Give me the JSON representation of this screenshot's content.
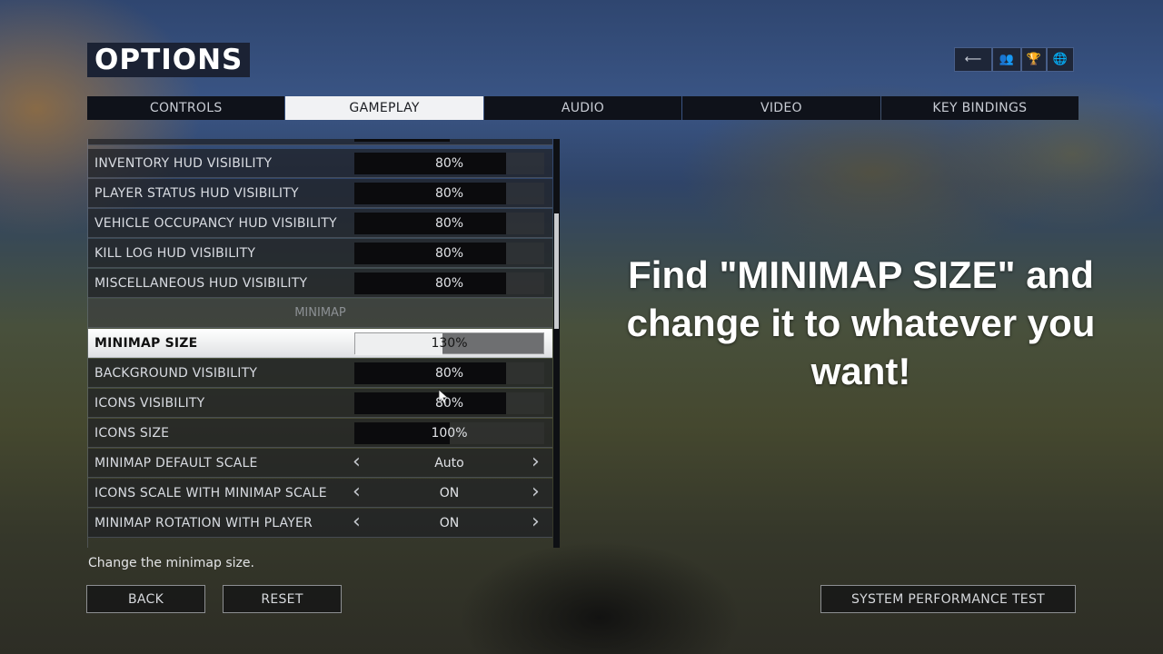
{
  "header": {
    "title": "OPTIONS"
  },
  "top_icons": [
    {
      "name": "back-arrow-icon",
      "glyph": "⟵"
    },
    {
      "name": "friends-icon",
      "glyph": "👥"
    },
    {
      "name": "trophy-icon",
      "glyph": "🏆"
    },
    {
      "name": "globe-icon",
      "glyph": "🌐"
    }
  ],
  "tabs": [
    {
      "label": "CONTROLS",
      "active": false
    },
    {
      "label": "GAMEPLAY",
      "active": true
    },
    {
      "label": "AUDIO",
      "active": false
    },
    {
      "label": "VIDEO",
      "active": false
    },
    {
      "label": "KEY BINDINGS",
      "active": false
    }
  ],
  "settings": {
    "rows": [
      {
        "label": "INVENTORY HUD VISIBILITY",
        "type": "slider",
        "value": "80%",
        "fraction": 0.8
      },
      {
        "label": "PLAYER STATUS HUD VISIBILITY",
        "type": "slider",
        "value": "80%",
        "fraction": 0.8
      },
      {
        "label": "VEHICLE OCCUPANCY HUD VISIBILITY",
        "type": "slider",
        "value": "80%",
        "fraction": 0.8
      },
      {
        "label": "KILL LOG HUD VISIBILITY",
        "type": "slider",
        "value": "80%",
        "fraction": 0.8
      },
      {
        "label": "MISCELLANEOUS HUD VISIBILITY",
        "type": "slider",
        "value": "80%",
        "fraction": 0.8
      },
      {
        "label": "MINIMAP",
        "type": "header"
      },
      {
        "label": "MINIMAP SIZE",
        "type": "slider",
        "value": "130%",
        "fraction": 0.46,
        "selected": true
      },
      {
        "label": "BACKGROUND VISIBILITY",
        "type": "slider",
        "value": "80%",
        "fraction": 0.8
      },
      {
        "label": "ICONS VISIBILITY",
        "type": "slider",
        "value": "80%",
        "fraction": 0.8
      },
      {
        "label": "ICONS SIZE",
        "type": "slider",
        "value": "100%",
        "fraction": 0.5
      },
      {
        "label": "MINIMAP DEFAULT SCALE",
        "type": "selector",
        "value": "Auto"
      },
      {
        "label": "ICONS SCALE WITH MINIMAP SCALE",
        "type": "selector",
        "value": "ON"
      },
      {
        "label": "MINIMAP ROTATION WITH PLAYER",
        "type": "selector",
        "value": "ON"
      }
    ],
    "partial_top_row_fraction": 0.5,
    "scroll_position": 0.35
  },
  "help_text": "Change the minimap size.",
  "buttons": {
    "back": "BACK",
    "reset": "RESET",
    "performance": "SYSTEM PERFORMANCE TEST"
  },
  "overlay_caption": "Find \"MINIMAP SIZE\" and change it to whatever you want!",
  "arrows": {
    "left": "‹",
    "right": "›"
  }
}
